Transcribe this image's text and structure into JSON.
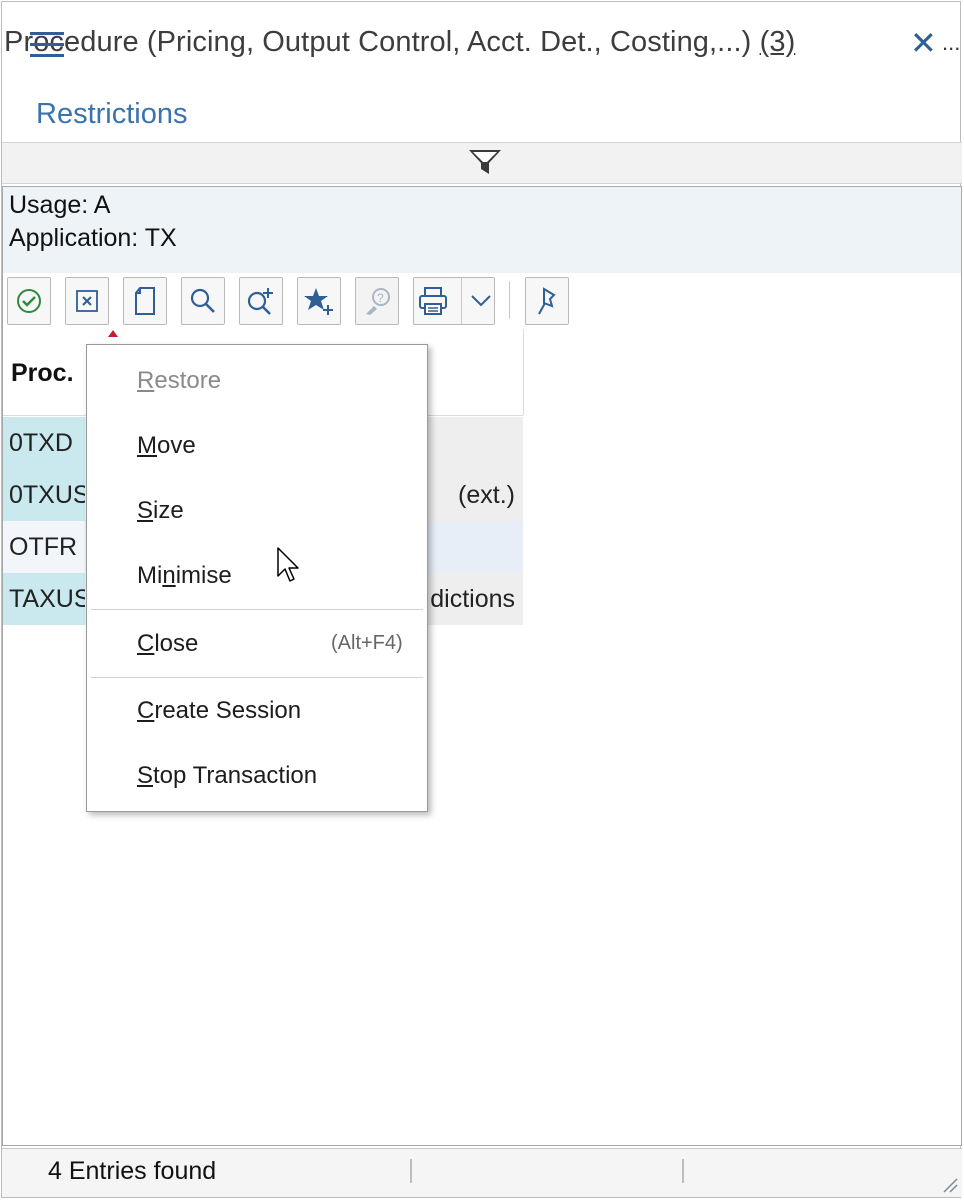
{
  "window": {
    "title": "Procedure (Pricing, Output Control, Acct. Det., Costing,...)",
    "title_count": "(3)",
    "close_glyph": "✕",
    "more_glyph": "..."
  },
  "section": {
    "restrictions_label": "Restrictions"
  },
  "info": {
    "usage": "Usage: A",
    "application": "Application: TX"
  },
  "toolbar": {
    "buttons": [
      "check-icon",
      "cancel-icon",
      "new-document-icon",
      "search-icon",
      "search-more-icon",
      "favorites-add-icon",
      "help-icon",
      "print-icon",
      "dropdown-icon",
      "pin-icon"
    ]
  },
  "grid": {
    "column_header": "Proc.",
    "rows": [
      {
        "key": "0TXD",
        "desc": ""
      },
      {
        "key": "0TXUS",
        "desc": "(ext.)"
      },
      {
        "key": "OTFR",
        "desc": ""
      },
      {
        "key": "TAXUS",
        "desc": "dictions"
      }
    ]
  },
  "context_menu": {
    "restore": "Restore",
    "move": "Move",
    "size": "Size",
    "minimise": "Minimise",
    "close": "Close",
    "close_shortcut": "(Alt+F4)",
    "create_session": "Create Session",
    "stop_transaction": "Stop Transaction"
  },
  "status": {
    "entries_found": "4 Entries found"
  },
  "colors": {
    "accent": "#2f5f95",
    "link": "#3a73ad",
    "key_cell_bg": "#c9e9ee",
    "info_bg": "#eef3f8"
  }
}
